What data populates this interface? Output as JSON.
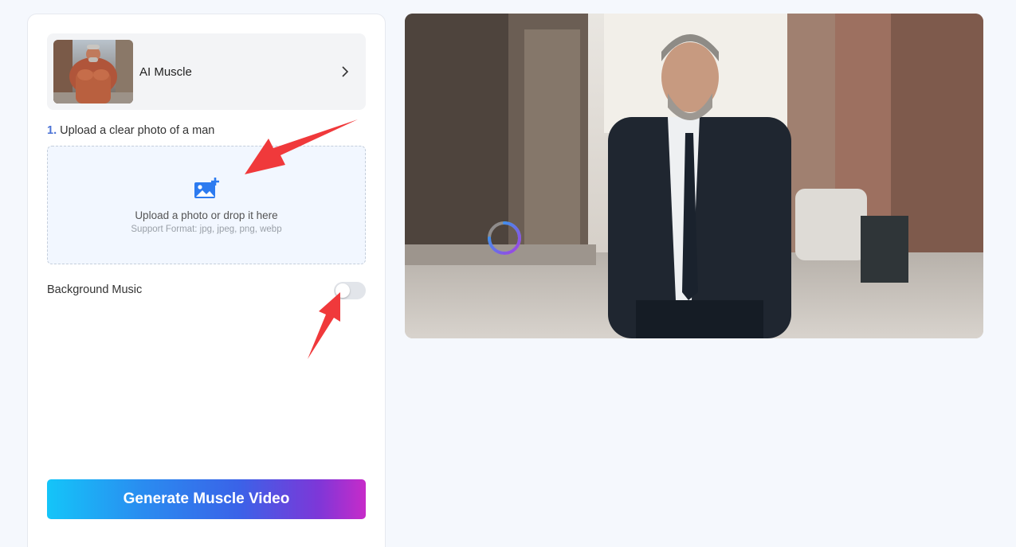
{
  "template": {
    "name": "AI Muscle"
  },
  "upload": {
    "step_number": "1.",
    "step_text": "Upload a clear photo of a man",
    "title": "Upload a photo or drop it here",
    "formats": "Support Format: jpg, jpeg, png, webp"
  },
  "music": {
    "label": "Background Music",
    "enabled": false
  },
  "generate": {
    "label": "Generate Muscle Video"
  },
  "colors": {
    "accent": "#4a72d6",
    "annotation_arrow": "#f0393b"
  },
  "icons": {
    "template_chevron": "chevron-right-icon",
    "upload": "image-plus-icon",
    "preview_loading": "loading-spinner-icon"
  }
}
